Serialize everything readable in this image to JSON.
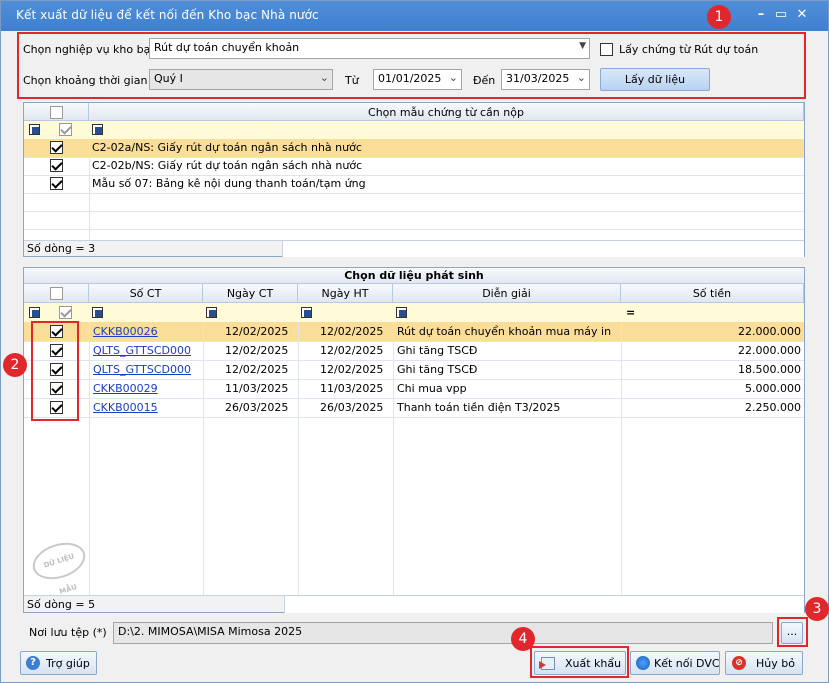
{
  "window": {
    "title": "Kết xuất dữ liệu để kết nối đến Kho bạc Nhà nước",
    "min_glyph": "–",
    "max_glyph": "▭",
    "close_glyph": "✕"
  },
  "top_form": {
    "operation_label": "Chọn nghiệp vụ kho bạc",
    "operation_value": "Rút dự toán chuyển khoản",
    "take_voucher_label": "Lấy chứng từ Rút dự toán",
    "period_label": "Chọn khoảng thời gian",
    "period_value": "Quý I",
    "from_label": "Từ",
    "from_value": "01/01/2025",
    "to_label": "Đến",
    "to_value": "31/03/2025",
    "get_data_label": "Lấy dữ liệu"
  },
  "template_panel": {
    "header": "Chọn mẫu chứng từ cần nộp",
    "rows": [
      {
        "checked": true,
        "label": "C2-02a/NS: Giấy rút dự toán ngân sách nhà nước"
      },
      {
        "checked": true,
        "label": "C2-02b/NS: Giấy rút dự toán ngân sách nhà nước"
      },
      {
        "checked": true,
        "label": "Mẫu số 07: Bảng kê nội dung thanh toán/tạm ứng"
      }
    ],
    "row_count": "Số dòng = 3"
  },
  "data_panel": {
    "title": "Chọn dữ liệu phát sinh",
    "columns": {
      "so_ct": "Số CT",
      "ngay_ct": "Ngày CT",
      "ngay_ht": "Ngày HT",
      "dien_giai": "Diễn giải",
      "so_tien": "Số tiền"
    },
    "filter_eq": "=",
    "rows": [
      {
        "checked": true,
        "so_ct": "CKKB00026",
        "ngay_ct": "12/02/2025",
        "ngay_ht": "12/02/2025",
        "dien_giai": "Rút dự toán chuyển khoản mua máy in",
        "so_tien": "22.000.000"
      },
      {
        "checked": true,
        "so_ct": "QLTS_GTTSCD000",
        "ngay_ct": "12/02/2025",
        "ngay_ht": "12/02/2025",
        "dien_giai": "Ghi tăng TSCĐ",
        "so_tien": "22.000.000"
      },
      {
        "checked": true,
        "so_ct": "QLTS_GTTSCD000",
        "ngay_ct": "12/02/2025",
        "ngay_ht": "12/02/2025",
        "dien_giai": "Ghi tăng TSCĐ",
        "so_tien": "18.500.000"
      },
      {
        "checked": true,
        "so_ct": "CKKB00029",
        "ngay_ct": "11/03/2025",
        "ngay_ht": "11/03/2025",
        "dien_giai": "Chi mua vpp",
        "so_tien": "5.000.000"
      },
      {
        "checked": true,
        "so_ct": "CKKB00015",
        "ngay_ct": "26/03/2025",
        "ngay_ht": "26/03/2025",
        "dien_giai": "Thanh toán tiền điện T3/2025",
        "so_tien": "2.250.000"
      }
    ],
    "row_count": "Số dòng = 5",
    "stamp_text": "DỮ LIỆU MẪU"
  },
  "save_path": {
    "label": "Nơi lưu tệp (*)",
    "value": "D:\\2. MIMOSA\\MISA Mimosa 2025",
    "browse_label": "..."
  },
  "footer": {
    "help_label": "Trợ giúp",
    "export_label": "Xuất khẩu",
    "connect_label": "Kết nối DVC",
    "cancel_label": "Hủy bỏ"
  },
  "badges": [
    "1",
    "2",
    "3",
    "4"
  ],
  "colors": {
    "title_bar": "#3f7fcf",
    "highlight_row": "#fbdd9a",
    "annotation_red": "#e0282c",
    "link": "#1a3fbf"
  }
}
